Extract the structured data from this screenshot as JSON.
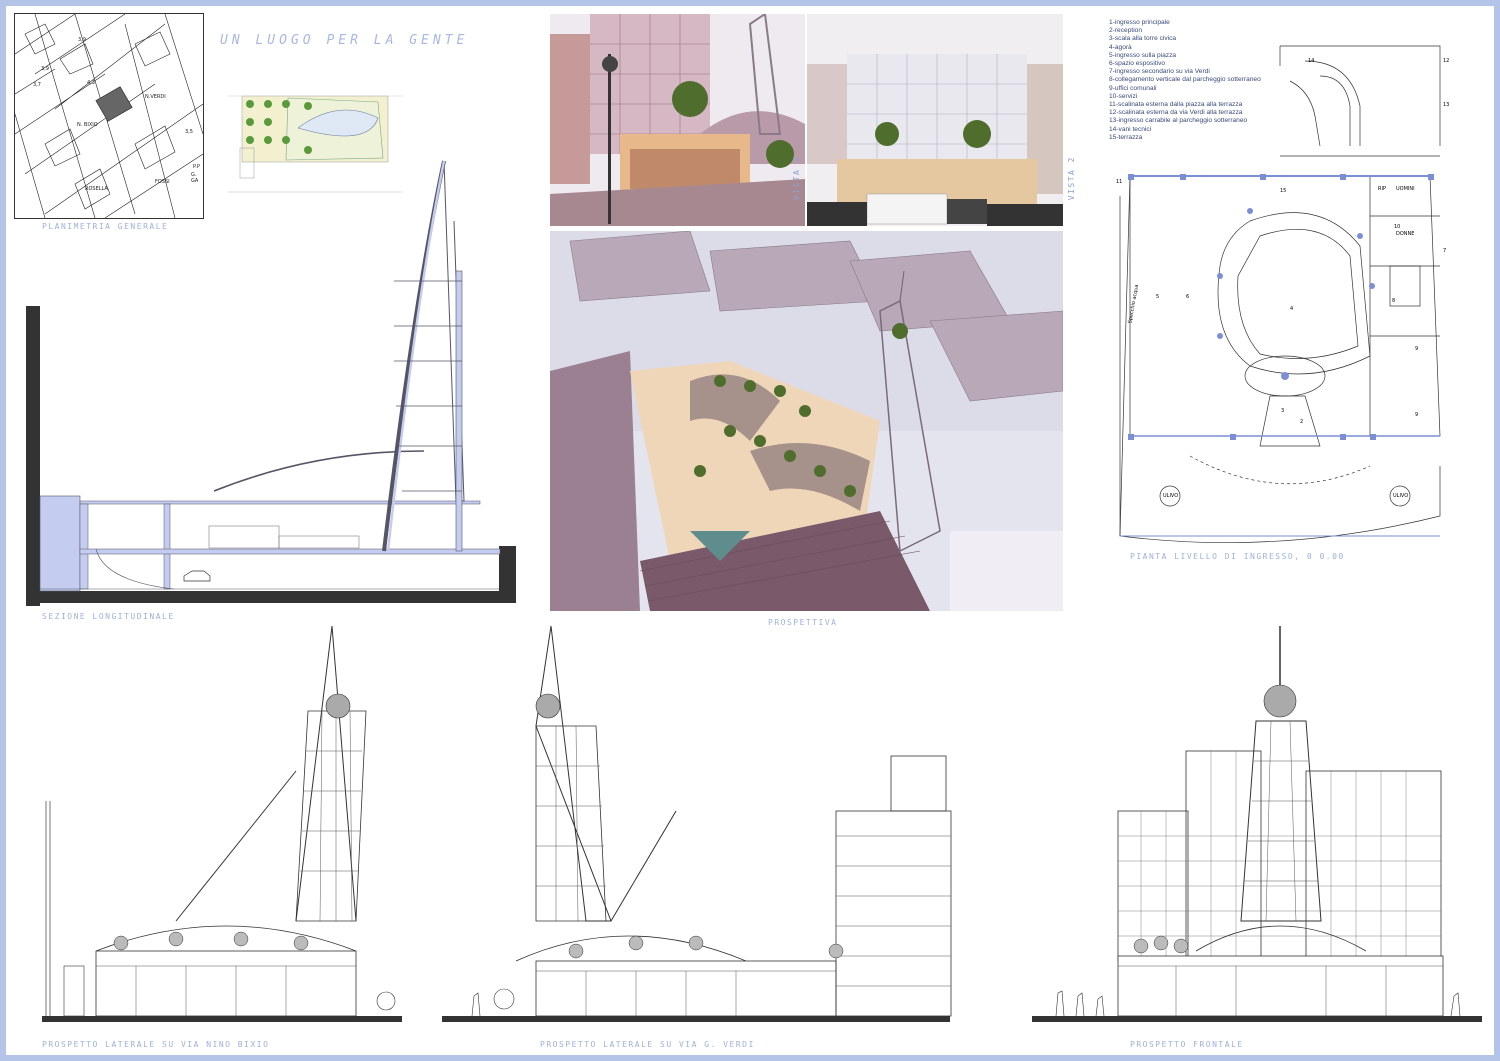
{
  "board": {
    "title": "UN LUOGO PER LA GENTE"
  },
  "captions": {
    "site_plan": "PLANIMETRIA GENERALE",
    "section": "SEZIONE LONGITUDINALE",
    "perspective": "PROSPETTIVA",
    "floor_plan": "PIANTA LIVELLO DI INGRESSO, 0    0.00",
    "elev_bixio": "PROSPETTO LATERALE SU VIA NINO BIXIO",
    "elev_verdi": "PROSPETTO LATERALE SU VIA G. VERDI",
    "elev_front": "PROSPETTO FRONTALE",
    "view1": "VISTA 1",
    "view2": "VISTA 2"
  },
  "legend": [
    "1-ingresso principale",
    "2-reception",
    "3-scala alla torre civica",
    "4-agorà",
    "5-ingresso sulla piazza",
    "6-spazio espositivo",
    "7-ingresso secondario su via Verdi",
    "8-collegamento verticale dal parcheggio sotterraneo",
    "9-uffici comunali",
    "10-servizi",
    "11-scalinata esterna dalla piazza alla terrazza",
    "12-scalinata esterna da via Verdi alla terrazza",
    "13-ingresso carrabile al parcheggio sotterraneo",
    "14-vani tecnici",
    "15-terrazza"
  ],
  "site_plan_labels": [
    "3,9",
    "3,9",
    "3,7",
    "4,3",
    "4,7",
    "N.VERDI",
    "N. BIXIO",
    "3,9",
    "3,5",
    "3,5",
    "3,1",
    "P.P",
    "G. GA",
    "ROSELLA",
    "FOSSI",
    "3,3",
    "3,8"
  ],
  "floor_plan_labels": {
    "rip": "RIP",
    "uomini": "UOMINI",
    "donne": "DONNE",
    "specchio": "Specchio acqua",
    "ulivo_1": "ULIVO",
    "ulivo_2": "ULIVO",
    "n14": "14",
    "n12": "12",
    "n13": "13",
    "n15": "15",
    "n10": "10",
    "n9a": "9",
    "n9b": "9",
    "n8": "8",
    "n7": "7",
    "n6": "6",
    "n5": "5",
    "n4": "4",
    "n3": "3",
    "n2": "2",
    "n11": "11"
  },
  "colors": {
    "background": "#b4c3e8",
    "accent": "#9fb0df",
    "tower": "#c4cdf0",
    "render_sky": "#e4e4ee",
    "render_roof": "#8a6a78"
  }
}
